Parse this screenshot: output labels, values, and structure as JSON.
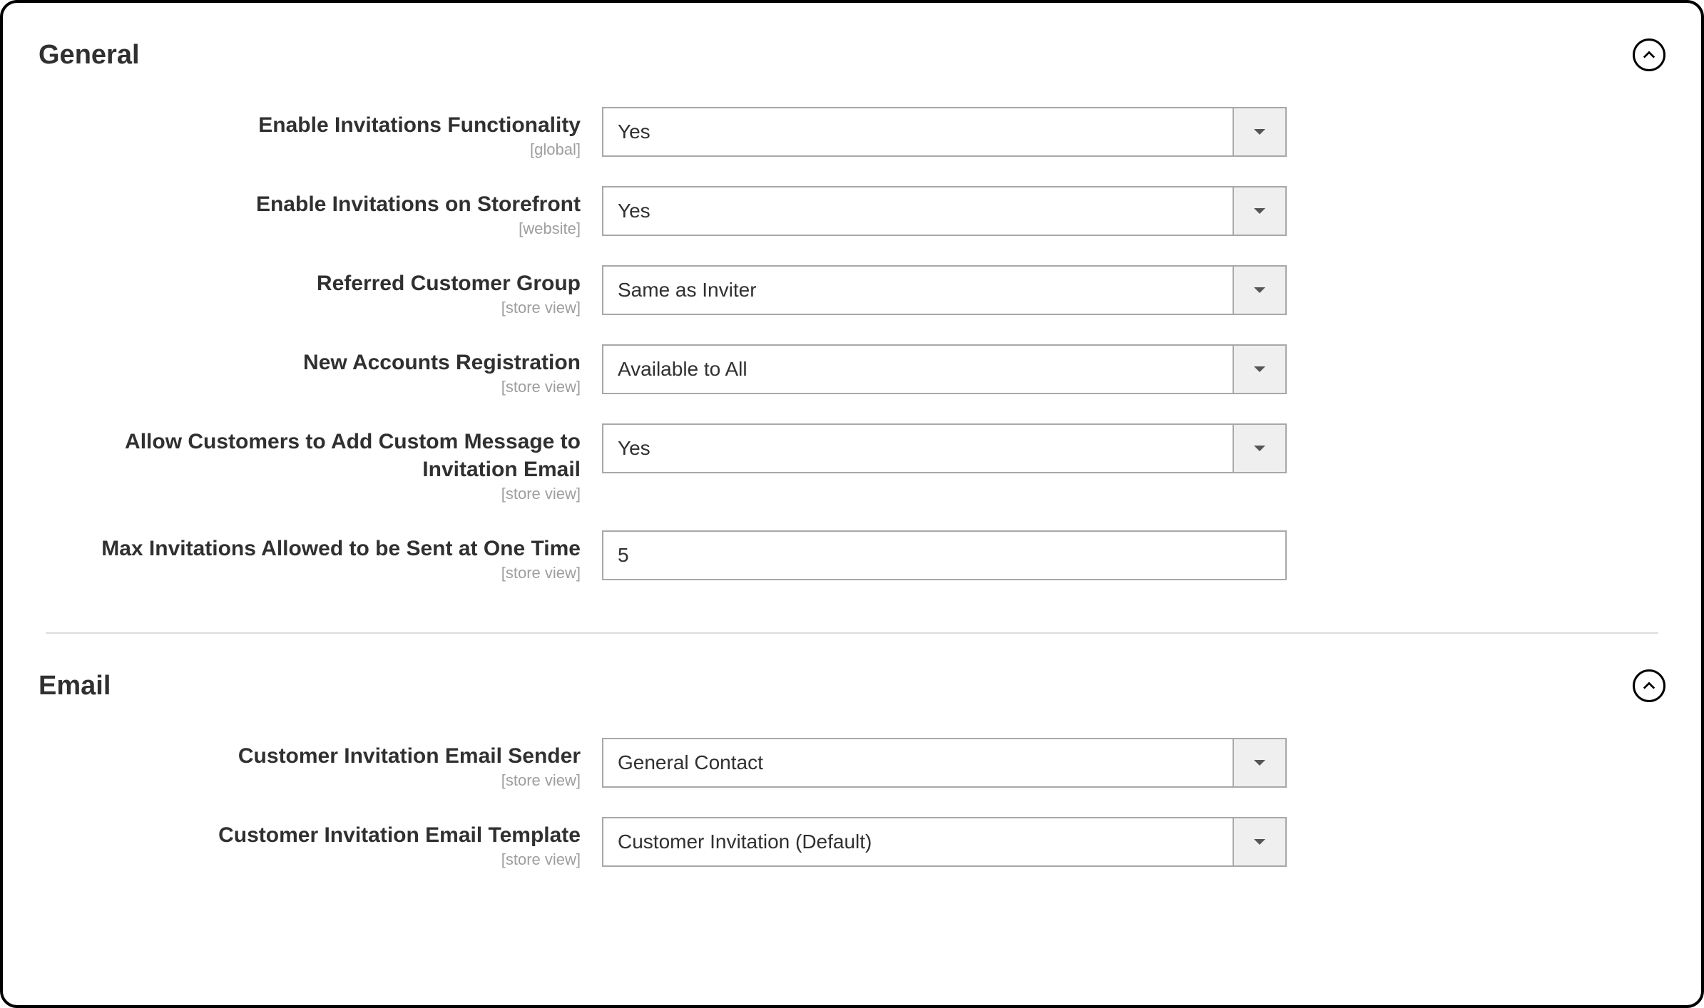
{
  "sections": {
    "general": {
      "title": "General",
      "fields": {
        "enable_invitations": {
          "label": "Enable Invitations Functionality",
          "scope": "[global]",
          "value": "Yes"
        },
        "enable_storefront": {
          "label": "Enable Invitations on Storefront",
          "scope": "[website]",
          "value": "Yes"
        },
        "referred_group": {
          "label": "Referred Customer Group",
          "scope": "[store view]",
          "value": "Same as Inviter"
        },
        "new_accounts": {
          "label": "New Accounts Registration",
          "scope": "[store view]",
          "value": "Available to All"
        },
        "allow_custom_msg": {
          "label": "Allow Customers to Add Custom Message to Invitation Email",
          "scope": "[store view]",
          "value": "Yes"
        },
        "max_invitations": {
          "label": "Max Invitations Allowed to be Sent at One Time",
          "scope": "[store view]",
          "value": "5"
        }
      }
    },
    "email": {
      "title": "Email",
      "fields": {
        "email_sender": {
          "label": "Customer Invitation Email Sender",
          "scope": "[store view]",
          "value": "General Contact"
        },
        "email_template": {
          "label": "Customer Invitation Email Template",
          "scope": "[store view]",
          "value": "Customer Invitation (Default)"
        }
      }
    }
  }
}
